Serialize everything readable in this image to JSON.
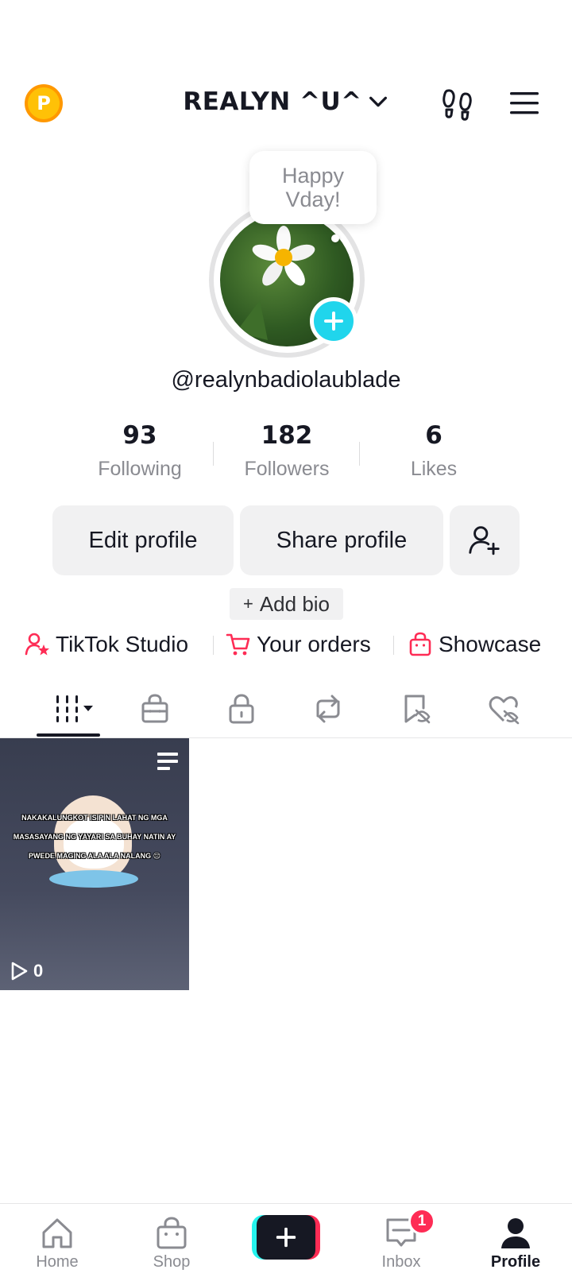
{
  "header": {
    "coin_letter": "P",
    "account_name": "REALYN ^U^",
    "icons": [
      "p-coin-icon",
      "chevron-down-icon",
      "footprint-icon",
      "menu-icon"
    ]
  },
  "profile": {
    "bubble_line1": "Happy",
    "bubble_line2": "Vday!",
    "username": "@realynbadiolaublade"
  },
  "stats": [
    {
      "value": "93",
      "label": "Following"
    },
    {
      "value": "182",
      "label": "Followers"
    },
    {
      "value": "6",
      "label": "Likes"
    }
  ],
  "buttons": {
    "edit": "Edit profile",
    "share": "Share profile",
    "add_bio": "Add bio"
  },
  "links": [
    {
      "label": "TikTok Studio",
      "icon": "creator-star-icon"
    },
    {
      "label": "Your orders",
      "icon": "cart-icon"
    },
    {
      "label": "Showcase",
      "icon": "shopping-bag-icon"
    }
  ],
  "tabs": [
    "videos-grid-icon",
    "shop-bag-icon",
    "lock-icon",
    "repost-icon",
    "favorites-hidden-icon",
    "liked-hidden-icon"
  ],
  "video": {
    "caption": "NAKAKALUNGKOT ISIPIN LAHAT NG MGA MASASAYANG NG YAYARI SA BUHAY NATIN AY PWEDE MAGING ALA ALA NALANG 😔",
    "views": "0"
  },
  "nav": {
    "home": "Home",
    "shop": "Shop",
    "inbox": "Inbox",
    "inbox_badge": "1",
    "profile": "Profile"
  },
  "colors": {
    "accent_pink": "#FE2C55",
    "accent_cyan": "#20D5EC",
    "text_primary": "#161823",
    "text_secondary": "#8a8b91",
    "button_bg": "#f1f1f2"
  }
}
